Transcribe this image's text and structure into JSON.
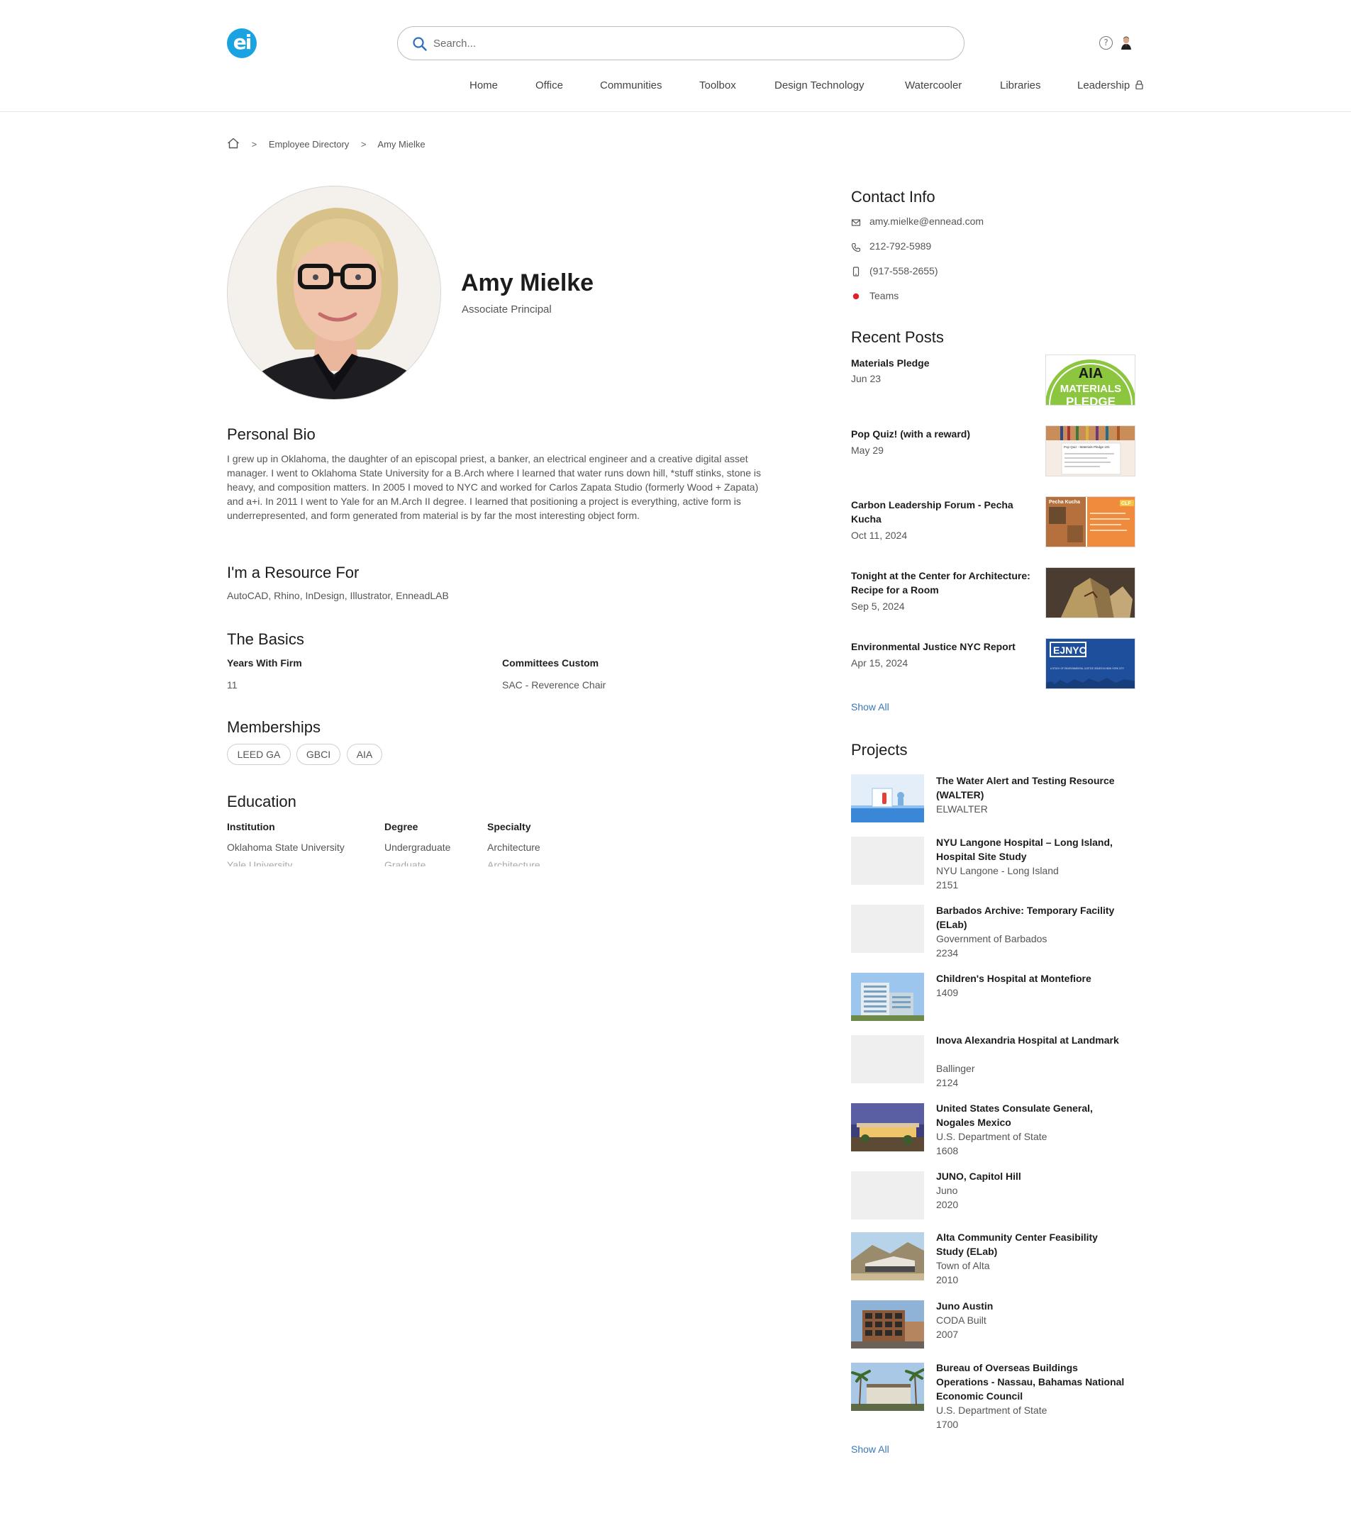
{
  "header": {
    "logo_text": "ei",
    "search_placeholder": "Search...",
    "nav": [
      "Home",
      "Office",
      "Communities",
      "Toolbox",
      "Design Technology",
      "Watercooler",
      "Libraries",
      "Leadership"
    ]
  },
  "breadcrumb": [
    "Employee Directory",
    "Amy Mielke"
  ],
  "profile": {
    "name": "Amy Mielke",
    "title": "Associate Principal"
  },
  "bio": {
    "heading": "Personal Bio",
    "text": "I grew up in Oklahoma, the daughter of an episcopal priest, a banker, an electrical engineer and a creative digital asset manager. I went to Oklahoma State University for a B.Arch where I learned that water runs down hill, *stuff stinks, stone is heavy, and composition matters. In 2005 I moved to NYC and worked for Carlos Zapata Studio (formerly Wood + Zapata) and a+i. In 2011 I went to Yale for an M.Arch II degree. I learned that positioning a project is everything, active form is underrepresented, and form generated from material is by far the most interesting object form."
  },
  "resource": {
    "heading": "I'm a Resource For",
    "text": "AutoCAD, Rhino, InDesign, Illustrator, EnneadLAB"
  },
  "basics": {
    "heading": "The Basics",
    "years_label": "Years With Firm",
    "years_value": "11",
    "committees_label": "Committees Custom",
    "committees_value": "SAC - Reverence Chair"
  },
  "memberships": {
    "heading": "Memberships",
    "items": [
      "LEED GA",
      "GBCI",
      "AIA"
    ]
  },
  "education": {
    "heading": "Education",
    "institution_label": "Institution",
    "degree_label": "Degree",
    "specialty_label": "Specialty",
    "institution": "Oklahoma State University",
    "degree": "Undergraduate",
    "specialty": "Architecture",
    "next_institution": "Yale University",
    "next_degree": "Graduate",
    "next_specialty": "Architecture"
  },
  "contact": {
    "heading": "Contact Info",
    "email": "amy.mielke@ennead.com",
    "phone": "212-792-5989",
    "mobile": "(917-558-2655)",
    "teams": "Teams"
  },
  "recent_posts": {
    "heading": "Recent Posts",
    "show_all": "Show All",
    "items": [
      {
        "title": "Materials Pledge",
        "date": "Jun 23",
        "thumb_text": [
          "AIA",
          "MATERIALS",
          "PLEDGE"
        ]
      },
      {
        "title": "Pop Quiz! (with a reward)",
        "date": "May 29",
        "thumb_text": [
          "Pop Quiz - Materials Pledge 101"
        ]
      },
      {
        "title": "Carbon Leadership Forum - Pecha Kucha",
        "date": "Oct 11, 2024",
        "thumb_text": [
          "Pecha Kucha",
          "CLF"
        ]
      },
      {
        "title": "Tonight at the Center for Architecture: Recipe for a Room",
        "date": "Sep 5, 2024"
      },
      {
        "title": "Environmental Justice NYC Report",
        "date": "Apr 15, 2024",
        "thumb_text": [
          "EJNYC",
          "A STUDY OF ENVIRONMENTAL JUSTICE ISSUES IN NEW YORK CITY"
        ]
      }
    ]
  },
  "projects": {
    "heading": "Projects",
    "show_all": "Show All",
    "items": [
      {
        "title": "The Water Alert and Testing Resource (WALTER)",
        "client": "ELWALTER",
        "number": ""
      },
      {
        "title": "NYU Langone Hospital – Long Island, Hospital Site Study",
        "client": "NYU Langone - Long Island",
        "number": "2151"
      },
      {
        "title": "Barbados Archive: Temporary Facility (ELab)",
        "client": "Government of Barbados",
        "number": "2234"
      },
      {
        "title": "Children's Hospital at Montefiore",
        "client": "1409",
        "number": ""
      },
      {
        "title": "Inova Alexandria Hospital at Landmark",
        "client": "Ballinger",
        "number": "2124"
      },
      {
        "title": "United States Consulate General, Nogales Mexico",
        "client": "U.S. Department of State",
        "number": "1608"
      },
      {
        "title": "JUNO, Capitol Hill",
        "client": "Juno",
        "number": "2020"
      },
      {
        "title": "Alta Community Center Feasibility Study (ELab)",
        "client": "Town of Alta",
        "number": "2010"
      },
      {
        "title": "Juno Austin",
        "client": "CODA Built",
        "number": "2007"
      },
      {
        "title": "Bureau of Overseas Buildings Operations - Nassau, Bahamas National Economic Council",
        "client": "U.S. Department of State",
        "number": "1700"
      }
    ]
  }
}
